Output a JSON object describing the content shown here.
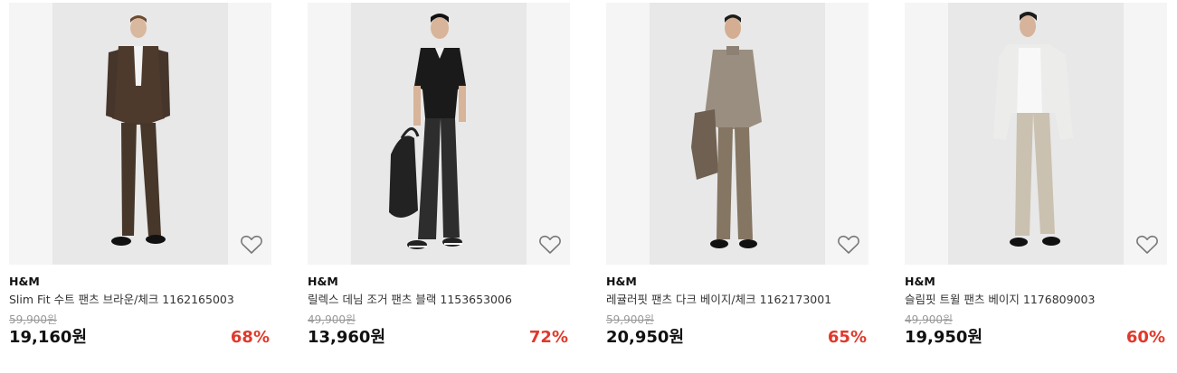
{
  "accent_sale_color": "#e0392b",
  "products": [
    {
      "brand": "H&M",
      "name": "Slim Fit 수트 팬츠 브라운/체크 1162165003",
      "original_price": "59,900원",
      "price": "19,160원",
      "discount": "68%",
      "wishlist_icon": "heart-outline-icon"
    },
    {
      "brand": "H&M",
      "name": "릴렉스 데님 조거 팬츠 블랙 1153653006",
      "original_price": "49,900원",
      "price": "13,960원",
      "discount": "72%",
      "wishlist_icon": "heart-outline-icon"
    },
    {
      "brand": "H&M",
      "name": "레귤러핏 팬츠 다크 베이지/체크 1162173001",
      "original_price": "59,900원",
      "price": "20,950원",
      "discount": "65%",
      "wishlist_icon": "heart-outline-icon"
    },
    {
      "brand": "H&M",
      "name": "슬림핏 트윌 팬츠 베이지 1176809003",
      "original_price": "49,900원",
      "price": "19,950원",
      "discount": "60%",
      "wishlist_icon": "heart-outline-icon"
    }
  ]
}
